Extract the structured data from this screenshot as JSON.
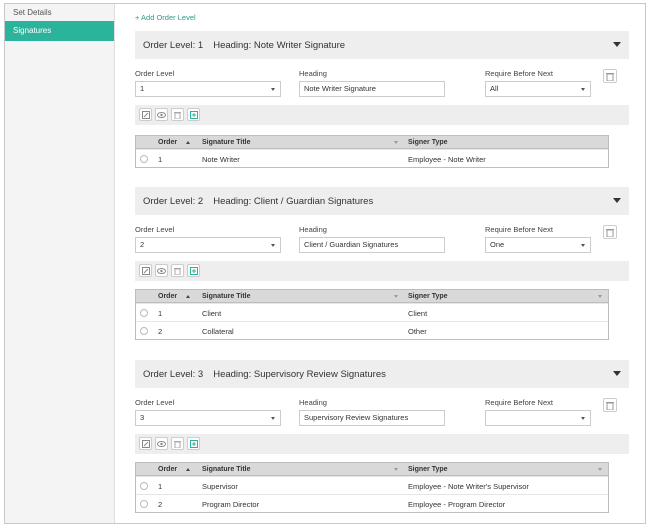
{
  "sidebar": {
    "items": [
      {
        "label": "Set Details"
      },
      {
        "label": "Signatures"
      }
    ]
  },
  "main": {
    "add_link": "+ Add Order Level"
  },
  "labels": {
    "order_level": "Order Level",
    "heading": "Heading",
    "require_before_next": "Require Before Next",
    "col_order": "Order",
    "col_signature_title": "Signature Title",
    "col_signer_type": "Signer Type"
  },
  "sections": [
    {
      "header_level": "Order Level: 1",
      "header_heading": "Heading: Note Writer Signature",
      "order_level_value": "1",
      "heading_value": "Note Writer Signature",
      "require_value": "All",
      "rows": [
        {
          "order": "1",
          "title": "Note Writer",
          "signer": "Employee - Note Writer"
        }
      ]
    },
    {
      "header_level": "Order Level: 2",
      "header_heading": "Heading: Client / Guardian Signatures",
      "order_level_value": "2",
      "heading_value": "Client / Guardian Signatures",
      "require_value": "One",
      "rows": [
        {
          "order": "1",
          "title": "Client",
          "signer": "Client"
        },
        {
          "order": "2",
          "title": "Collateral",
          "signer": "Other"
        }
      ]
    },
    {
      "header_level": "Order Level: 3",
      "header_heading": "Heading: Supervisory Review Signatures",
      "order_level_value": "3",
      "heading_value": "Supervisory Review Signatures",
      "require_value": "",
      "rows": [
        {
          "order": "1",
          "title": "Supervisor",
          "signer": "Employee - Note Writer's Supervisor"
        },
        {
          "order": "2",
          "title": "Program Director",
          "signer": "Employee - Program Director"
        }
      ]
    }
  ],
  "icons": {
    "toolbar": [
      "edit-icon",
      "view-icon",
      "delete-icon",
      "add-icon"
    ],
    "section_delete": "trash-icon",
    "section_toggle": "caret-down-icon"
  },
  "colors": {
    "accent": "#2bb39c",
    "link": "#2c9b87",
    "header_bg": "#eeeeee",
    "grid_head_bg": "#d9d9d9"
  }
}
